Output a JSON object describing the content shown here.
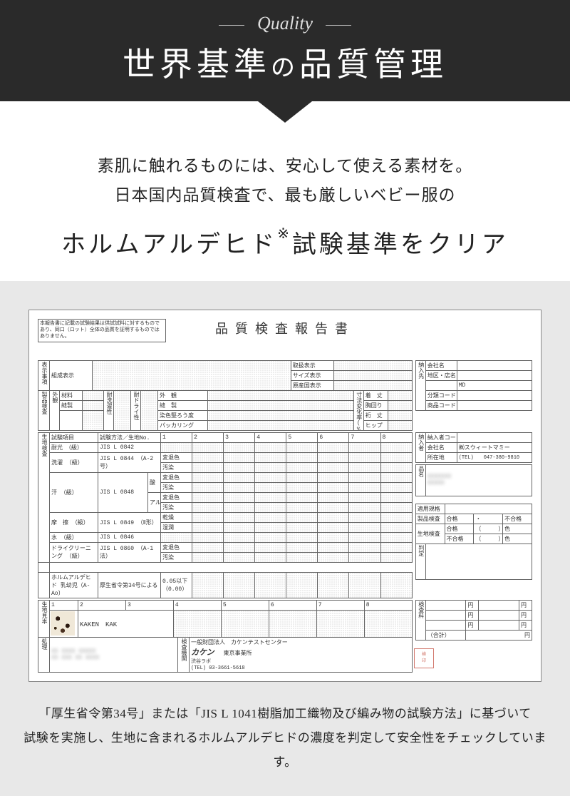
{
  "header": {
    "script": "Quality",
    "title_a": "世界基準",
    "title_no": "の",
    "title_b": "品質管理"
  },
  "intro": {
    "line1": "素肌に触れるものには、安心して使える素材を。",
    "line2": "日本国内品質検査で、最も厳しいベビー服の",
    "bold": "ホルムアルデヒド",
    "sup": "※",
    "bold_tail": "試験基準をクリア"
  },
  "report": {
    "title": "品質検査報告書",
    "disclaimer": "本報告書に記載の試験結果は供試試料に対するものであり、同口（ロット）全体の品質を証明するものではありません。",
    "sections": {
      "display_items": "表示事項",
      "display_rows": [
        "組成表示"
      ],
      "display_cols": [
        "取扱表示",
        "サイズ表示",
        "原産国表示"
      ],
      "product_inspect": "製品検査",
      "appearance": "外観",
      "appearance_rows": [
        "材料",
        "縫製"
      ],
      "appearance_cols": [
        "耐洗濯性",
        "耐ドライ性"
      ],
      "gaikan": "外　観",
      "gaikan_rows": [
        "縫　製",
        "染色堅ろう度",
        "パッカリング"
      ],
      "dimension": "寸法変化率(%)",
      "dimension_rows": [
        "着　丈",
        "胸回り",
        "裄　丈",
        "ヒップ"
      ],
      "fabric_test": "生地検査",
      "test_item_label": "試験項目",
      "test_method_label": "試験方法／生地No.",
      "num_cols": [
        "1",
        "2",
        "3",
        "4",
        "5",
        "6",
        "7",
        "8"
      ],
      "tests": [
        {
          "name": "耐光　（級）",
          "method": "JIS L 0842"
        },
        {
          "name": "洗濯\n（級）",
          "method": "JIS L 0844\n（A-2号）"
        },
        {
          "name": "汗\n（級）",
          "method": "JIS L 0848",
          "sub": [
            "酸",
            "アルカリ"
          ]
        },
        {
          "name": "摩　擦\n（級）",
          "method": "JIS L 0849\n（Ⅱ形）"
        },
        {
          "name": "水\n（級）",
          "method": "JIS L 0846"
        },
        {
          "name": "ドライクリーニング\n（級）",
          "method": "JIS L 0860\n（A-1法）"
        }
      ],
      "test_subcols": [
        "変退色",
        "汚染",
        "変退色",
        "汚染",
        "変退色",
        "汚染",
        "乾燥",
        "湿潤",
        "変退色",
        "汚染"
      ],
      "formaldehyde": "ホルムアルデヒド\n乳幼児（A-Ao）",
      "formaldehyde_method": "厚生省令第34号による",
      "formaldehyde_limit": "0.05以下\n（0.00）",
      "sample_label": "生地見本",
      "sample_text": "KAKEN　KAK",
      "process_label": "処理",
      "inspect_org_label": "検査機関",
      "inspect_org_text1": "一般財団法人　カケンテストセンター",
      "inspect_org_brand": "カケン",
      "inspect_org_text2": "東京事業所",
      "inspect_org_text3": "渋谷ラボ\n(TEL) 03-3661-5618"
    },
    "right": {
      "delivery": "納入先",
      "r1": [
        "会社名",
        ""
      ],
      "r2": [
        "地区・店名",
        ""
      ],
      "r3": [
        "",
        "MD"
      ],
      "r4": [
        "分類コード",
        ""
      ],
      "r5": [
        "商品コード",
        ""
      ],
      "supplier": "納入者",
      "s1": [
        "納入者コード",
        ""
      ],
      "s2": [
        "会社名",
        "㈱スウィートマミー"
      ],
      "s3": [
        "所在地",
        "(TEL)　　047-380-9810"
      ],
      "product": "品名",
      "spec": "適用規格",
      "spec_rows": [
        "製品検査",
        "生地検査"
      ],
      "spec_cols": [
        "合格",
        "・",
        "不合格"
      ],
      "spec_sub": [
        "合格",
        "（　　　）",
        "色",
        "不合格",
        "（　　　）",
        "色"
      ],
      "judge": "判定",
      "inspect_fee": "検査料",
      "fee_unit": "円",
      "total": "（合計）"
    }
  },
  "footer": "「厚生省令第34号」または「JIS L 1041樹脂加工織物及び編み物の試験方法」に基づいて\n試験を実施し、生地に含まれるホルムアルデヒドの濃度を判定して安全性をチェックしています。"
}
